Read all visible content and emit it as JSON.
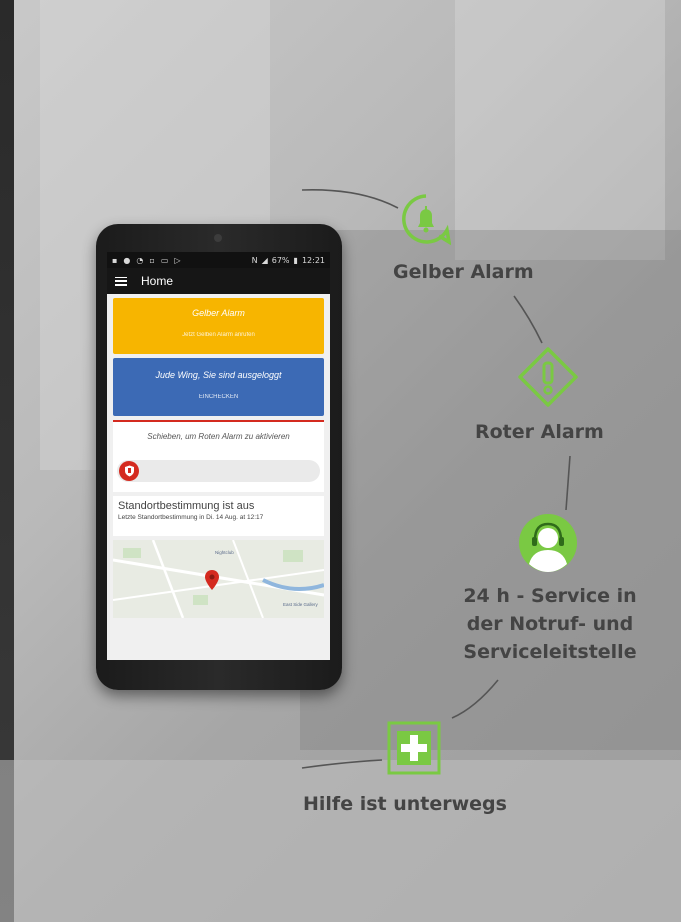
{
  "phone": {
    "status_bar": {
      "right_text": "67%",
      "time": "12:21"
    },
    "app_bar": {
      "title": "Home"
    },
    "yellow_card": {
      "title": "Gelber Alarm",
      "subtitle": "Jetzt Gelben Alarm anrufen",
      "color": "#f7b500"
    },
    "blue_card": {
      "title": "Jude Wing, Sie sind ausgeloggt",
      "action": "EINCHECKEN",
      "color": "#3c6ab5"
    },
    "red_slider": {
      "text": "Schieben, um Roten Alarm zu aktivieren",
      "color": "#d42a1f"
    },
    "location": {
      "title": "Standortbestimmung ist aus",
      "subtitle": "Letzte Standortbestimmung in Di. 14 Aug. at 12:17"
    },
    "map": {
      "labels": [
        "Nightclub",
        "East Side Gallery"
      ]
    }
  },
  "callouts": {
    "yellow": {
      "label": "Gelber Alarm",
      "icon": "bell-icon"
    },
    "red": {
      "label": "Roter Alarm",
      "icon": "warning-diamond-icon"
    },
    "service": {
      "lines": [
        "24 h - Service in",
        "der Notruf- und",
        "Serviceleitstelle"
      ],
      "icon": "headset-operator-icon"
    },
    "help": {
      "label": "Hilfe ist unterwegs",
      "icon": "medical-cross-icon"
    }
  },
  "accent_color": "#7ac943"
}
